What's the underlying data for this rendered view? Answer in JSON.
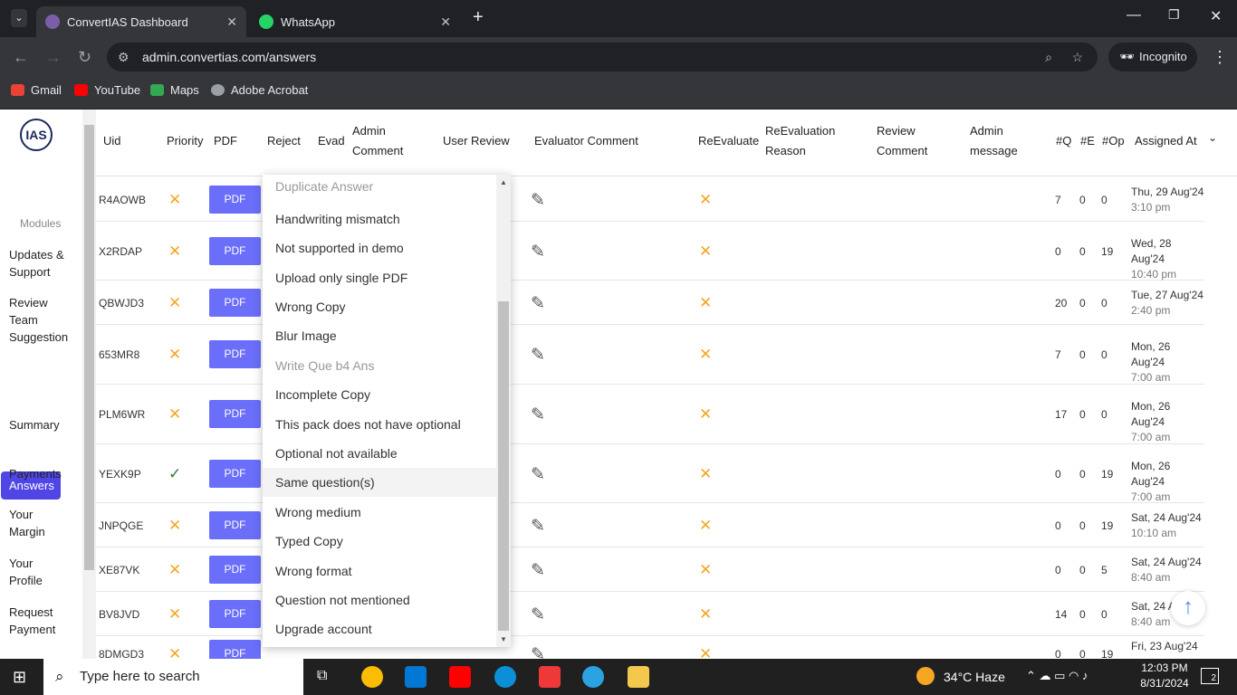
{
  "browser": {
    "tabs": [
      {
        "title": "ConvertIAS Dashboard"
      },
      {
        "title": "WhatsApp"
      }
    ],
    "url": "admin.convertias.com/answers",
    "incognito_label": "Incognito",
    "bookmarks": [
      "Gmail",
      "YouTube",
      "Maps",
      "Adobe Acrobat"
    ]
  },
  "sidebar": {
    "logo": "IAS",
    "section_label": "Modules",
    "items": [
      {
        "label": "Updates & Support"
      },
      {
        "label": "Review Team Suggestion"
      },
      {
        "label": "Answers"
      },
      {
        "label": "Summary"
      },
      {
        "label": "Payments"
      },
      {
        "label": "Your Margin"
      },
      {
        "label": "Your Profile"
      },
      {
        "label": "Request Payment"
      }
    ]
  },
  "table": {
    "headers": {
      "uid": "Uid",
      "priority": "Priority",
      "pdf": "PDF",
      "reject": "Reject",
      "evad": "Evad",
      "admin_comment": "Admin Comment",
      "user_review": "User Review",
      "evaluator_comment": "Evaluator Comment",
      "reevaluate": "ReEvaluate",
      "reevaluation_reason": "ReEvaluation Reason",
      "review_comment": "Review Comment",
      "admin_message": "Admin message",
      "q": "#Q",
      "e": "#E",
      "op": "#Op",
      "assigned_at": "Assigned At"
    },
    "pdf_label": "PDF",
    "rows": [
      {
        "uid": "R4AOWB",
        "priority": "x",
        "q": "7",
        "e": "0",
        "op": "0",
        "date": "Thu, 29 Aug'24",
        "time": "3:10 pm"
      },
      {
        "uid": "X2RDAP",
        "priority": "x",
        "q": "0",
        "e": "0",
        "op": "19",
        "date": "Wed, 28 Aug'24",
        "time": "10:40 pm"
      },
      {
        "uid": "QBWJD3",
        "priority": "x",
        "q": "20",
        "e": "0",
        "op": "0",
        "date": "Tue, 27 Aug'24",
        "time": "2:40 pm"
      },
      {
        "uid": "653MR8",
        "priority": "x",
        "q": "7",
        "e": "0",
        "op": "0",
        "date": "Mon, 26 Aug'24",
        "time": "7:00 am"
      },
      {
        "uid": "PLM6WR",
        "priority": "x",
        "q": "17",
        "e": "0",
        "op": "0",
        "date": "Mon, 26 Aug'24",
        "time": "7:00 am"
      },
      {
        "uid": "YEXK9P",
        "priority": "check",
        "q": "0",
        "e": "0",
        "op": "19",
        "date": "Mon, 26 Aug'24",
        "time": "7:00 am"
      },
      {
        "uid": "JNPQGE",
        "priority": "x",
        "q": "0",
        "e": "0",
        "op": "19",
        "date": "Sat, 24 Aug'24",
        "time": "10:10 am"
      },
      {
        "uid": "XE87VK",
        "priority": "x",
        "q": "0",
        "e": "0",
        "op": "5",
        "date": "Sat, 24 Aug'24",
        "time": "8:40 am"
      },
      {
        "uid": "BV8JVD",
        "priority": "x",
        "q": "14",
        "e": "0",
        "op": "0",
        "date": "Sat, 24 A",
        "time": "8:40 am"
      },
      {
        "uid": "8DMGD3",
        "priority": "x",
        "q": "0",
        "e": "0",
        "op": "19",
        "date": "Fri, 23 Aug'24",
        "time": ""
      }
    ]
  },
  "reject_dropdown": {
    "options": [
      {
        "label": "Duplicate Answer",
        "disabled": true
      },
      {
        "label": "Handwriting mismatch"
      },
      {
        "label": "Not supported in demo"
      },
      {
        "label": "Upload only single PDF"
      },
      {
        "label": "Wrong Copy"
      },
      {
        "label": "Blur Image"
      },
      {
        "label": "Write Que b4 Ans",
        "disabled": true
      },
      {
        "label": "Incomplete Copy"
      },
      {
        "label": "This pack does not have optional"
      },
      {
        "label": "Optional not available"
      },
      {
        "label": "Same question(s)",
        "highlighted": true
      },
      {
        "label": "Wrong medium"
      },
      {
        "label": "Typed Copy"
      },
      {
        "label": "Wrong format"
      },
      {
        "label": "Question not mentioned"
      },
      {
        "label": "Upgrade account"
      }
    ]
  },
  "taskbar": {
    "search_placeholder": "Type here to search",
    "weather": "34°C  Haze",
    "time": "12:03 PM",
    "date": "8/31/2024",
    "notifications": "2"
  },
  "colors": {
    "accent": "#4f46e5",
    "pdf_button": "#6b6ef9",
    "cross": "#f5a623",
    "check": "#2e7d32"
  }
}
